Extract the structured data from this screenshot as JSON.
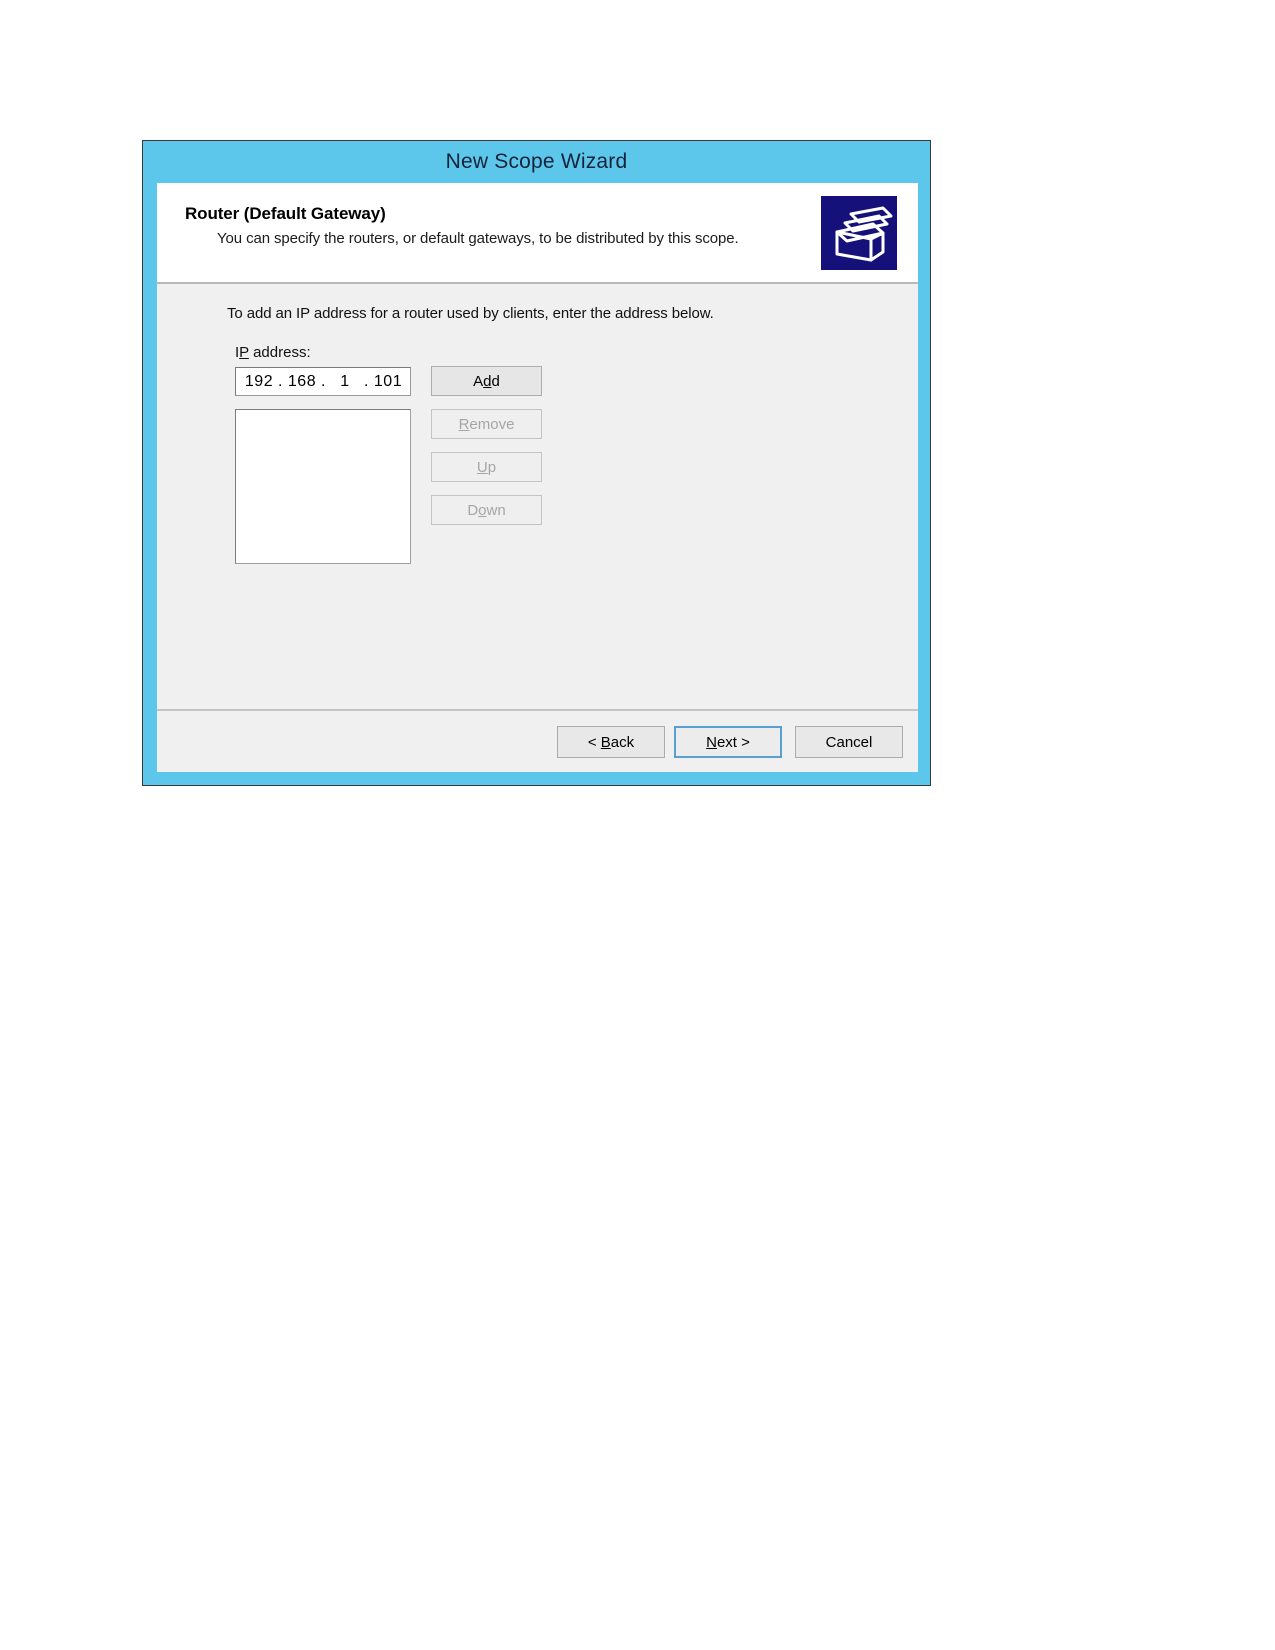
{
  "window": {
    "title": "New Scope Wizard",
    "title_bar_color": "#5CC7EA",
    "body_color": "#F0F0F0"
  },
  "header": {
    "title": "Router (Default Gateway)",
    "subtitle": "You can specify the routers, or default gateways, to be distributed by this scope.",
    "icon_name": "folder-stack-icon",
    "icon_background": "#16107A"
  },
  "body": {
    "instruction": "To add an IP address for a router used by clients, enter the address below.",
    "ip_address_label": {
      "prefix": "I",
      "accel": "P",
      "suffix": " address:"
    },
    "ip_address": {
      "octet1": "192",
      "octet2": "168",
      "octet3": "1",
      "octet4": "101",
      "separator": "."
    },
    "router_list": {
      "items": []
    },
    "side_buttons": [
      {
        "name": "add-button",
        "prefix": "A",
        "accel": "d",
        "suffix": "d",
        "enabled": true
      },
      {
        "name": "remove-button",
        "prefix": "",
        "accel": "R",
        "suffix": "emove",
        "enabled": false
      },
      {
        "name": "up-button",
        "prefix": "",
        "accel": "U",
        "suffix": "p",
        "enabled": false
      },
      {
        "name": "down-button",
        "prefix": "D",
        "accel": "o",
        "suffix": "wn",
        "enabled": false
      }
    ]
  },
  "footer": {
    "back_label": "< Back",
    "back_accel": "B",
    "next_label": "Next >",
    "next_accel": "N",
    "cancel_label": "Cancel",
    "default_button": "next-button"
  }
}
